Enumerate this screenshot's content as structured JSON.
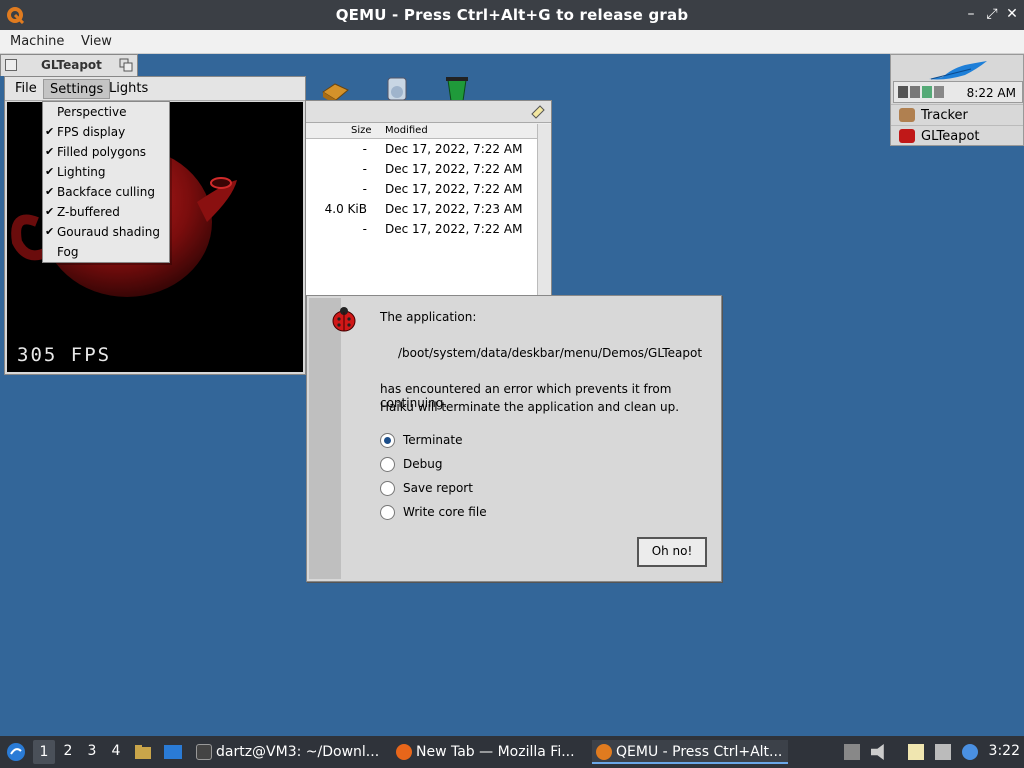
{
  "qemu": {
    "title": "QEMU - Press Ctrl+Alt+G to release grab",
    "menu": [
      "Machine",
      "View"
    ],
    "controls": [
      "–",
      "⤢",
      "✕"
    ]
  },
  "deskbar": {
    "clock": "8:22 AM",
    "apps": [
      "Tracker",
      "GLTeapot"
    ]
  },
  "tracker": {
    "columns": {
      "size": "Size",
      "modified": "Modified"
    },
    "rows": [
      {
        "size": "-",
        "modified": "Dec 17, 2022, 7:22 AM"
      },
      {
        "size": "-",
        "modified": "Dec 17, 2022, 7:22 AM"
      },
      {
        "size": "-",
        "modified": "Dec 17, 2022, 7:22 AM"
      },
      {
        "size": "4.0 KiB",
        "modified": "Dec 17, 2022, 7:23 AM"
      },
      {
        "size": "-",
        "modified": "Dec 17, 2022, 7:22 AM"
      }
    ]
  },
  "glteapot": {
    "title": "GLTeapot",
    "menu": [
      "File",
      "Settings",
      "Lights"
    ],
    "active_menu": "Settings",
    "fps": "305 FPS",
    "settings_items": [
      {
        "label": "Perspective",
        "checked": false
      },
      {
        "label": "FPS display",
        "checked": true
      },
      {
        "label": "Filled polygons",
        "checked": true
      },
      {
        "label": "Lighting",
        "checked": true
      },
      {
        "label": "Backface culling",
        "checked": true
      },
      {
        "label": "Z-buffered",
        "checked": true
      },
      {
        "label": "Gouraud shading",
        "checked": true
      },
      {
        "label": "Fog",
        "checked": false
      }
    ],
    "check_mark": "✔"
  },
  "dialog": {
    "line1": "The application:",
    "path": "/boot/system/data/deskbar/menu/Demos/GLTeapot",
    "line3": "has encountered an error which prevents it from continuing.",
    "line4": "Haiku will terminate the application and clean up.",
    "options": [
      {
        "label": "Terminate",
        "selected": true
      },
      {
        "label": "Debug",
        "selected": false
      },
      {
        "label": "Save report",
        "selected": false
      },
      {
        "label": "Write core file",
        "selected": false
      }
    ],
    "button": "Oh no!"
  },
  "taskbar": {
    "workspaces": [
      "1",
      "2",
      "3",
      "4"
    ],
    "active_workspace": "1",
    "tasks": [
      {
        "label": "dartz@VM3: ~/Downl...",
        "icon": "terminal-icon",
        "active": false
      },
      {
        "label": "New Tab — Mozilla Fi...",
        "icon": "firefox-icon",
        "active": false
      },
      {
        "label": "QEMU - Press Ctrl+Alt...",
        "icon": "qemu-icon",
        "active": true
      }
    ],
    "clock": "3:22"
  },
  "colors": {
    "desktop": "#336699",
    "host_bar": "#2f333a",
    "teapot": "#b01818",
    "accent": "#6aa7e8"
  }
}
